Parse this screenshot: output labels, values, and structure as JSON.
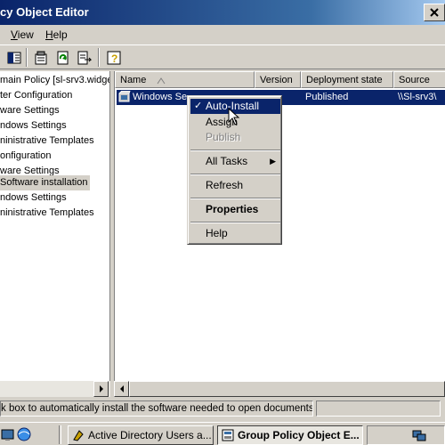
{
  "window": {
    "title": "cy Object Editor"
  },
  "menubar": {
    "items": [
      {
        "label": "View",
        "hotkey": "V",
        "rest": "iew"
      },
      {
        "label": "Help",
        "hotkey": "H",
        "rest": "elp"
      }
    ]
  },
  "toolbar": {
    "buttons": [
      "show-hide-tree-icon",
      "properties-icon",
      "refresh-icon",
      "export-list-icon",
      "help-icon"
    ]
  },
  "tree": {
    "items": [
      "main Policy [sl-srv3.widge",
      "ter Configuration",
      "ware Settings",
      "ndows Settings",
      "ninistrative Templates",
      "onfiguration",
      "ware Settings",
      "Software installation",
      "ndows Settings",
      "ninistrative Templates"
    ],
    "selected_index": 7
  },
  "list": {
    "columns": [
      {
        "label": "Name"
      },
      {
        "label": "Version"
      },
      {
        "label": "Deployment state"
      },
      {
        "label": "Source"
      }
    ],
    "rows": [
      {
        "name": "Windows Se",
        "version": "",
        "state": "Published",
        "source": "\\\\Sl-srv3\\"
      }
    ]
  },
  "context_menu": {
    "items": [
      {
        "label": "Auto-Install",
        "checked": true,
        "highlighted": true
      },
      {
        "label": "Assign"
      },
      {
        "label": "Publish",
        "disabled": true
      },
      {
        "label": "All Tasks",
        "submenu": true
      },
      {
        "label": "Refresh"
      },
      {
        "label": "Properties",
        "bold": true
      },
      {
        "label": "Help"
      }
    ]
  },
  "statusbar": {
    "text": "k box to automatically install the software needed to open documents"
  },
  "taskbar": {
    "buttons": [
      {
        "label": "Active Directory Users a...",
        "active": false
      },
      {
        "label": "Group Policy Object E...",
        "active": true
      }
    ]
  },
  "colors": {
    "titlebar_start": "#0a246a",
    "selection": "#0a246a",
    "face": "#d4d0c8"
  }
}
